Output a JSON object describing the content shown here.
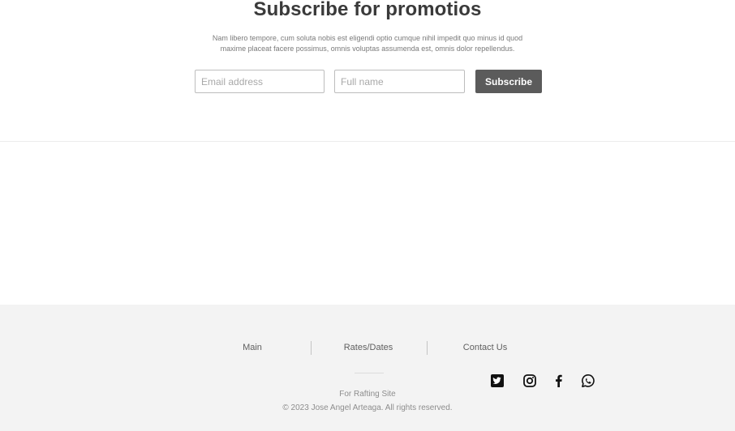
{
  "subscribe": {
    "title": "Subscribe for promotios",
    "description": "Nam libero tempore, cum soluta nobis est eligendi optio cumque nihil impedit quo minus id quod maxime placeat facere possimus, omnis voluptas assumenda est, omnis dolor repellendus.",
    "email_placeholder": "Email address",
    "name_placeholder": "Full name",
    "button_label": "Subscribe"
  },
  "footer": {
    "nav": [
      {
        "label": "Main"
      },
      {
        "label": "Rates/Dates"
      },
      {
        "label": "Contact Us"
      }
    ],
    "social_icons": [
      "twitter-icon",
      "instagram-icon",
      "facebook-icon",
      "whatsapp-icon"
    ],
    "site_line": "For Rafting Site",
    "copyright": "© 2023 Jose Angel Arteaga.  All rights reserved."
  },
  "colors": {
    "button_bg": "#5b5b5b",
    "footer_bg": "#f3f3f3"
  }
}
